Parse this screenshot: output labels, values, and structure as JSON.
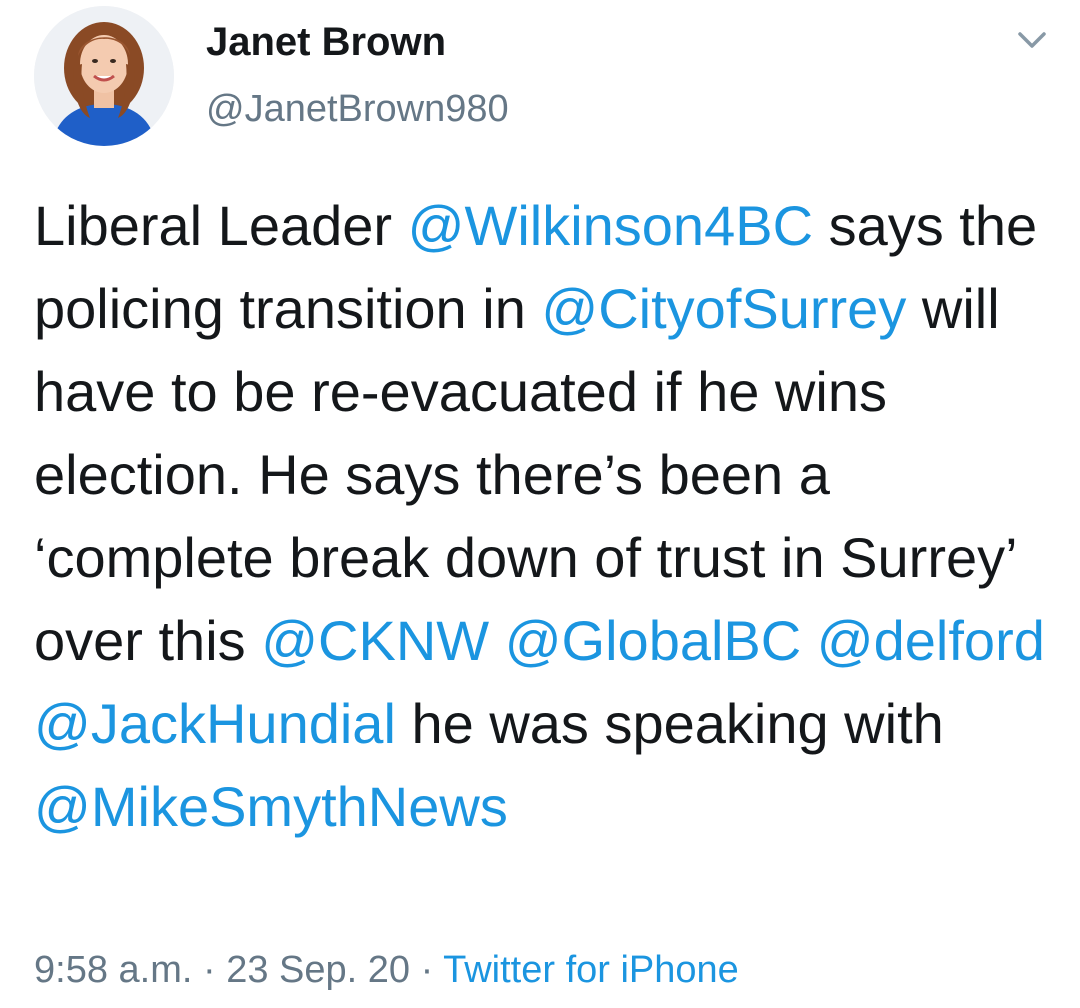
{
  "user": {
    "display_name": "Janet Brown",
    "handle": "@JanetBrown980",
    "avatar": "profile-photo"
  },
  "menu": {
    "icon": "chevron-down-icon"
  },
  "tweet": {
    "segments": [
      {
        "text": "Liberal Leader ",
        "type": "text"
      },
      {
        "text": "@Wilkinson4BC",
        "type": "mention"
      },
      {
        "text": " says the policing transition in ",
        "type": "text"
      },
      {
        "text": "@CityofSurrey",
        "type": "mention"
      },
      {
        "text": " will have to be re-evacuated if he wins election. He says there’s been a ‘complete break down of trust in Surrey’ over this ",
        "type": "text"
      },
      {
        "text": "@CKNW",
        "type": "mention"
      },
      {
        "text": " ",
        "type": "text"
      },
      {
        "text": "@GlobalBC",
        "type": "mention"
      },
      {
        "text": " ",
        "type": "text"
      },
      {
        "text": "@delford",
        "type": "mention"
      },
      {
        "text": " ",
        "type": "text"
      },
      {
        "text": "@JackHundial",
        "type": "mention"
      },
      {
        "text": " he was speaking with ",
        "type": "text"
      },
      {
        "text": "@MikeSmythNews",
        "type": "mention"
      }
    ]
  },
  "meta": {
    "time": "9:58 a.m.",
    "separator": " · ",
    "date": "23 Sep. 20",
    "source": "Twitter for iPhone"
  },
  "colors": {
    "mention": "#1b95e0",
    "secondary_text": "#657786",
    "primary_text": "#14171a"
  }
}
